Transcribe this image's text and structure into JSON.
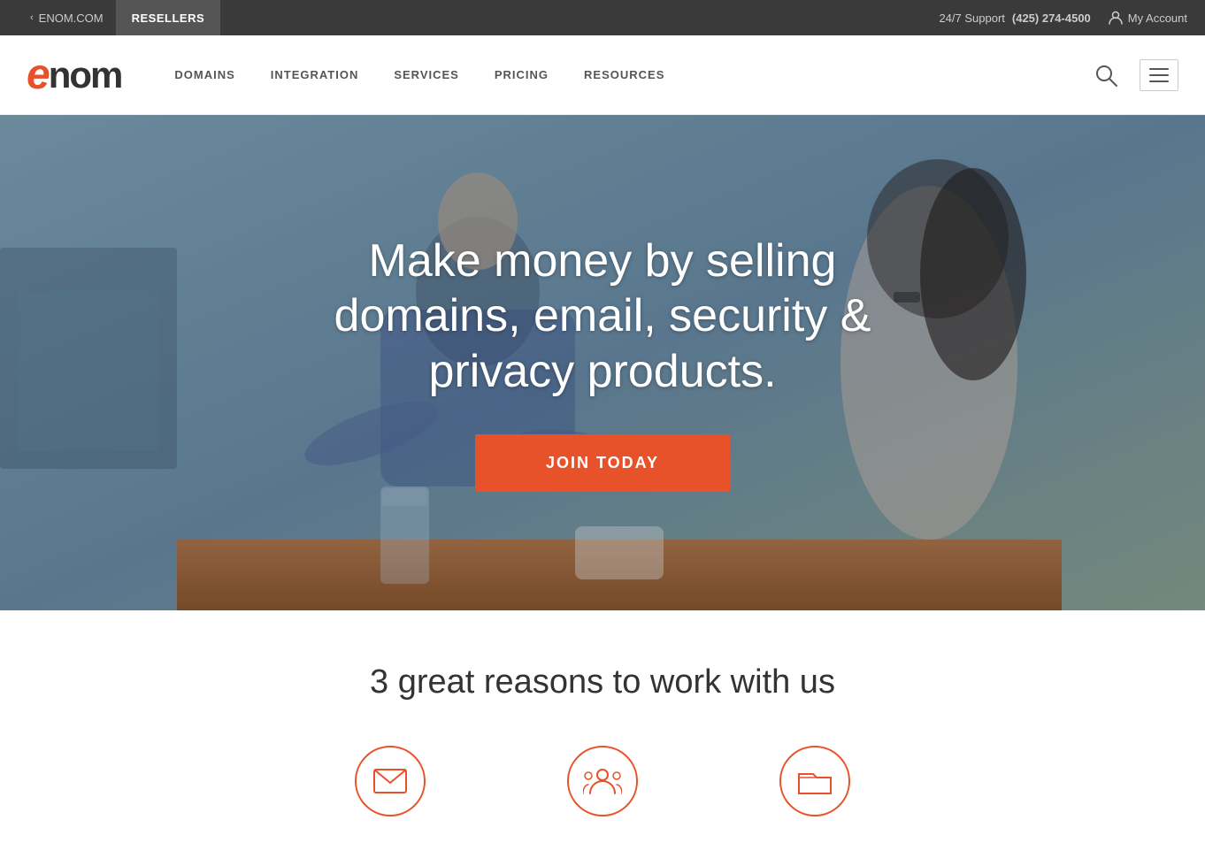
{
  "topbar": {
    "back_label": "ENOM.COM",
    "current_label": "RESELLERS",
    "support_label": "24/7 Support",
    "phone": "(425) 274-4500",
    "account_label": "My Account"
  },
  "nav": {
    "logo_e": "e",
    "logo_rest": "nom",
    "links": [
      {
        "label": "DOMAINS"
      },
      {
        "label": "INTEGRATION"
      },
      {
        "label": "SERVICES"
      },
      {
        "label": "PRICING"
      },
      {
        "label": "RESOURCES"
      }
    ]
  },
  "hero": {
    "headline": "Make money by selling domains, email, security & privacy products.",
    "cta_label": "JOIN TODAY"
  },
  "reasons": {
    "title": "3 great reasons to work with us",
    "icons": [
      {
        "name": "envelope-icon",
        "shape": "envelope"
      },
      {
        "name": "group-icon",
        "shape": "group"
      },
      {
        "name": "folder-icon",
        "shape": "folder"
      }
    ]
  }
}
